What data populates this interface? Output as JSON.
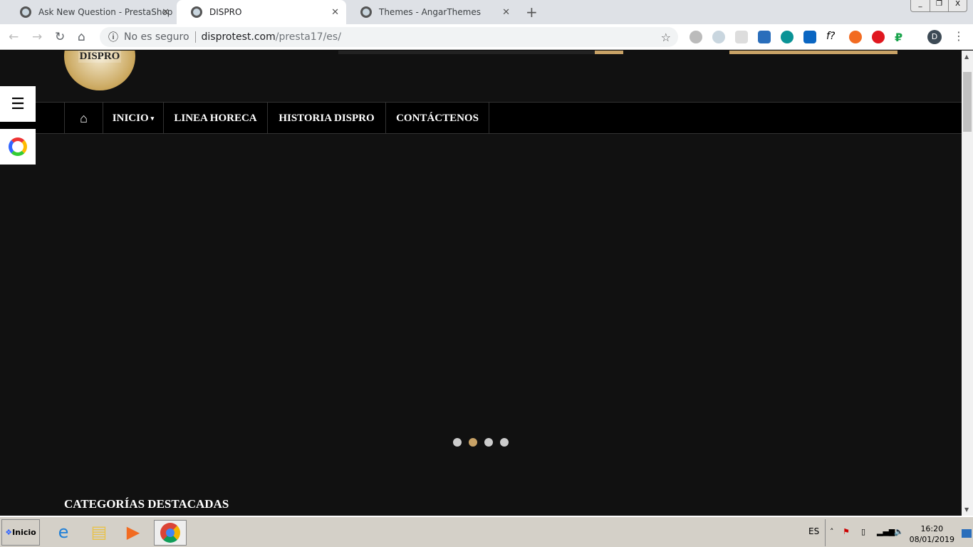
{
  "browser": {
    "tabs": [
      {
        "title": "Ask New Question - PrestaShop",
        "active": false
      },
      {
        "title": "DISPRO",
        "active": true
      },
      {
        "title": "Themes - AngarThemes",
        "active": false
      }
    ],
    "security_label": "No es seguro",
    "url_host": "disprotest.com",
    "url_path": "/presta17/es/",
    "profile_initial": "D",
    "extensions": [
      "skype-icon",
      "prestashop-icon",
      "eyedropper-icon",
      "s-icon",
      "palette-icon",
      "linkedin-icon",
      "font-icon",
      "lifebuoy-icon",
      "adobe-icon",
      "ruble-icon"
    ]
  },
  "site": {
    "logo_text": "DISPRO",
    "nav": [
      {
        "label": "INICIO",
        "has_dropdown": true
      },
      {
        "label": "LINEA HORECA"
      },
      {
        "label": "HISTORIA DISPRO"
      },
      {
        "label": "CONTÁCTENOS"
      }
    ],
    "slider": {
      "slides": 4,
      "active_index": 1
    },
    "section_title": "CATEGORÍAS DESTACADAS",
    "accent": "#c8a266"
  },
  "taskbar": {
    "start_label": "Inicio",
    "language": "ES",
    "time": "16:20",
    "date": "08/01/2019"
  }
}
